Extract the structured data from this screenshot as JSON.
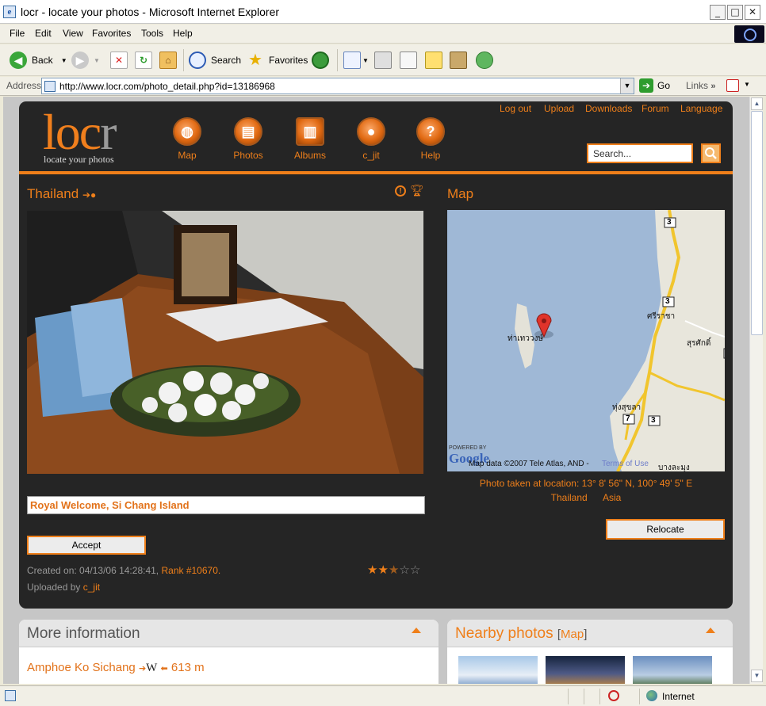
{
  "window": {
    "title": "locr - locate your photos - Microsoft Internet Explorer",
    "controls": {
      "minimize": "_",
      "maximize": "□",
      "close": "✕"
    }
  },
  "menu": [
    "File",
    "Edit",
    "View",
    "Favorites",
    "Tools",
    "Help"
  ],
  "toolbar": {
    "back": "Back",
    "search": "Search",
    "favorites": "Favorites"
  },
  "address": {
    "label": "Address",
    "url": "http://www.locr.com/photo_detail.php?id=13186968",
    "go": "Go",
    "links": "Links"
  },
  "site": {
    "logo_main": "loc",
    "logo_end": "r",
    "tagline": "locate your photos",
    "nav": [
      "Map",
      "Photos",
      "Albums",
      "c_jit",
      "Help"
    ],
    "top_links": [
      "Log out",
      "Upload",
      "Downloads",
      "Forum",
      "Language"
    ],
    "search_placeholder": "Search..."
  },
  "photo": {
    "title": "Thailand",
    "caption": "Royal Welcome, Si Chang Island",
    "accept": "Accept",
    "created_label": "Created on: 04/13/06 14:28:41,",
    "rank": "Rank #10670",
    "rank_suffix": ".",
    "uploaded_label": "Uploaded by",
    "uploader": "c_jit",
    "rating_stars": 2.5
  },
  "map": {
    "title": "Map",
    "location_text": "Photo taken at location: 13° 8' 56\" N, 100° 49' 5\" E",
    "country": "Thailand",
    "continent": "Asia",
    "relocate": "Relocate",
    "labels": {
      "island": "ท่าเทววงษ์",
      "town1": "ศรีราชา",
      "town2": "สุรศักดิ์",
      "town3": "ทุ่งสุขลา",
      "town4": "บางละมุง",
      "road_3": "3",
      "road_7": "7",
      "powered": "POWERED BY",
      "google": "Google",
      "copyright": "Map data ©2007 Tele Atlas, AND -",
      "terms": "Terms of Use"
    }
  },
  "more_info": {
    "title": "More information",
    "place": "Amphoe Ko Sichang",
    "wiki": "W",
    "distance": "613 m"
  },
  "nearby": {
    "title": "Nearby photos",
    "bracket_open": "[",
    "map_link": "Map",
    "bracket_close": "]"
  },
  "status": {
    "zone": "Internet"
  },
  "colors": {
    "accent": "#ef7f1a",
    "panel": "#252525"
  }
}
